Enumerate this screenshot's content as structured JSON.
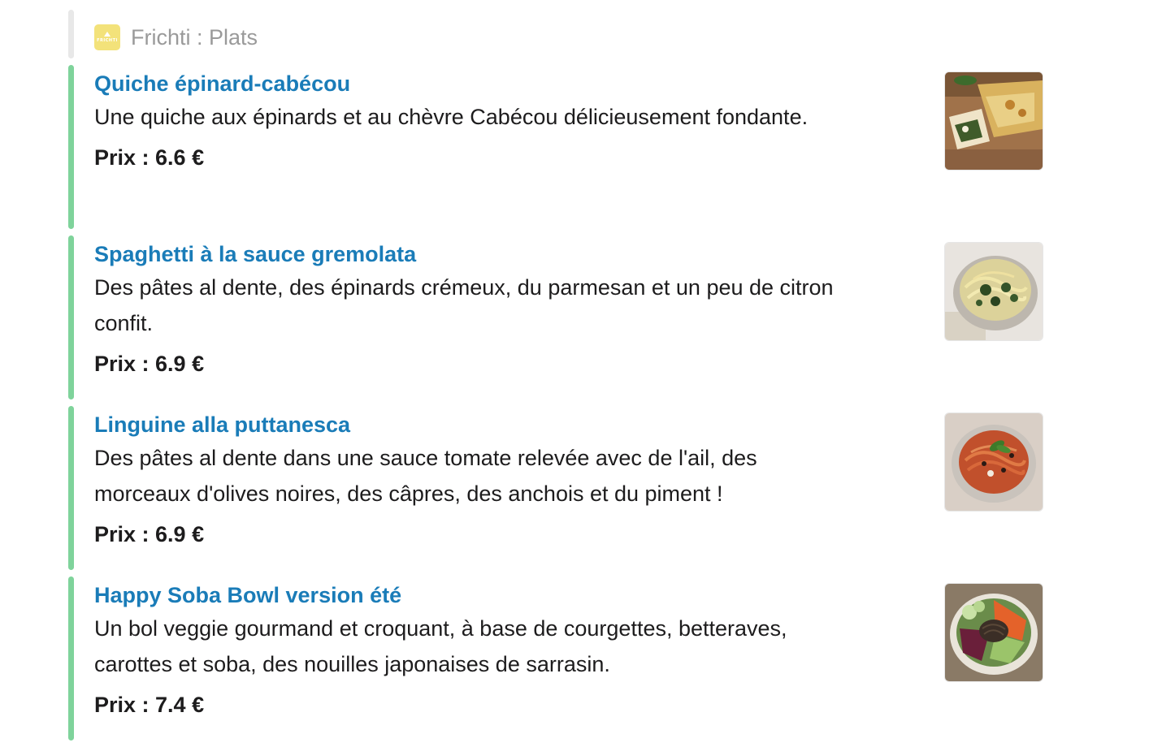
{
  "header": {
    "logo_text": "FRICHTI",
    "title": "Frichti : Plats"
  },
  "items": [
    {
      "title": "Quiche épinard-cabécou",
      "description": "Une quiche aux épinards et au chèvre Cabécou délicieusement fondante.",
      "price": "Prix : 6.6 €",
      "image": "quiche-photo"
    },
    {
      "title": "Spaghetti à la sauce gremolata",
      "description": "Des pâtes al dente, des épinards crémeux, du parmesan et un peu de citron confit.",
      "price": "Prix : 6.9 €",
      "image": "spaghetti-gremolata-photo"
    },
    {
      "title": "Linguine alla puttanesca",
      "description": "Des pâtes al dente dans une sauce tomate relevée avec de l'ail, des morceaux d'olives noires, des câpres, des anchois et du piment !",
      "price": "Prix : 6.9 €",
      "image": "linguine-puttanesca-photo"
    },
    {
      "title": "Happy Soba Bowl version été",
      "description": "Un bol veggie gourmand et croquant, à base de courgettes, betteraves, carottes et soba, des nouilles japonaises de sarrasin.",
      "price": "Prix : 7.4 €",
      "image": "soba-bowl-photo"
    }
  ],
  "colors": {
    "accent_bar": "#7fd39b",
    "title_link": "#1a7cb8",
    "header_bar": "#e8e8e8",
    "logo_bg": "#f3e27a"
  }
}
